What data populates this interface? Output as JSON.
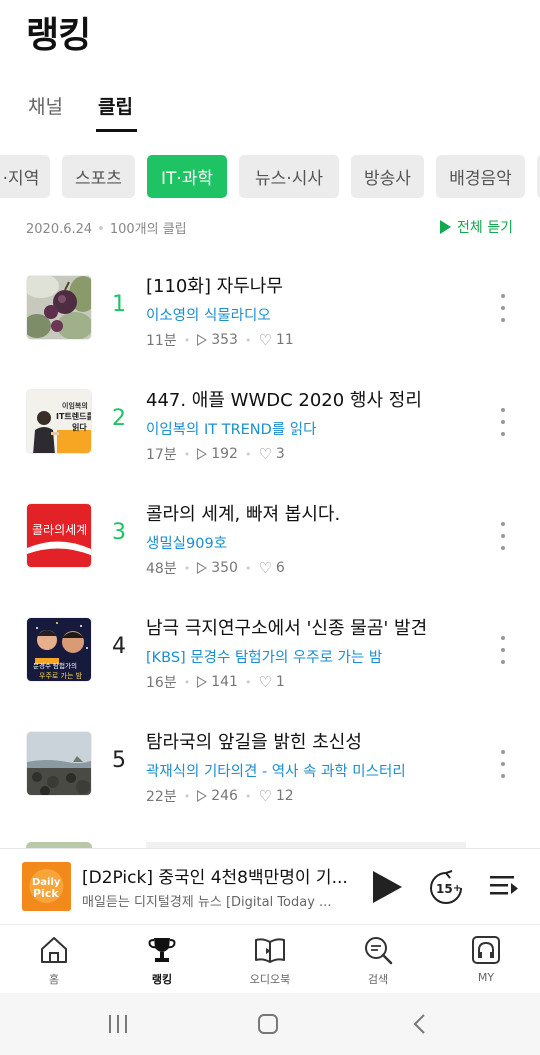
{
  "page": {
    "title": "랭킹"
  },
  "tabs": [
    {
      "label": "채널",
      "active": false
    },
    {
      "label": "클립",
      "active": true
    }
  ],
  "categories": [
    {
      "label": "·지역",
      "active": false
    },
    {
      "label": "스포츠",
      "active": false
    },
    {
      "label": "IT·과학",
      "active": true
    },
    {
      "label": "뉴스·시사",
      "active": false
    },
    {
      "label": "방송사",
      "active": false
    },
    {
      "label": "배경음악",
      "active": false
    }
  ],
  "meta": {
    "date": "2020.6.24",
    "count": "100개의 클립",
    "play_all": "전체 듣기"
  },
  "items": [
    {
      "rank": "1",
      "title": "[110화] 자두나무",
      "channel": "이소영의 식물라디오",
      "duration": "11분",
      "plays": "353",
      "likes": "11",
      "thumb_icon": "plum-photo"
    },
    {
      "rank": "2",
      "title": "447. 애플 WWDC 2020 행사 정리",
      "channel": "이임복의 IT TREND를 읽다",
      "duration": "17분",
      "plays": "192",
      "likes": "3",
      "thumb_icon": "it-trend-cover",
      "thumb_text": [
        "이임복의",
        "IT트렌드를",
        "읽다"
      ]
    },
    {
      "rank": "3",
      "title": "콜라의 세계, 빠져 봅시다.",
      "channel": "생밀실909호",
      "duration": "48분",
      "plays": "350",
      "likes": "6",
      "thumb_icon": "cola-cover",
      "thumb_text": [
        "콜라의세계"
      ]
    },
    {
      "rank": "4",
      "title": "남극 극지연구소에서 '신종 물곰' 발견",
      "channel": "[KBS] 문경수 탐험가의 우주로 가는 밤",
      "duration": "16분",
      "plays": "141",
      "likes": "1",
      "thumb_icon": "space-night-cover",
      "thumb_text": [
        "문경수 탐험가의",
        "우주로 가는 밤"
      ]
    },
    {
      "rank": "5",
      "title": "탐라국의 앞길을 밝힌 초신성",
      "channel": "곽재식의 기타의견 - 역사 속 과학 미스터리",
      "duration": "22분",
      "plays": "246",
      "likes": "12",
      "thumb_icon": "coast-photo"
    }
  ],
  "player": {
    "title": "[D2Pick] 중국인 4천8백만명이 기...",
    "subtitle": "매일듣는 디지털경제 뉴스 [Digital Today ...",
    "thumb_text": [
      "Daily",
      "Pick"
    ],
    "skip_label": "15"
  },
  "bottom_nav": [
    {
      "label": "홈",
      "icon": "home-icon",
      "active": false
    },
    {
      "label": "랭킹",
      "icon": "trophy-icon",
      "active": true
    },
    {
      "label": "오디오북",
      "icon": "audiobook-icon",
      "active": false
    },
    {
      "label": "검색",
      "icon": "search-icon",
      "active": false
    },
    {
      "label": "MY",
      "icon": "headphones-icon",
      "active": false
    }
  ],
  "colors": {
    "accent": "#1ec464",
    "link": "#1b8fd1",
    "chip_bg": "#ececec"
  }
}
